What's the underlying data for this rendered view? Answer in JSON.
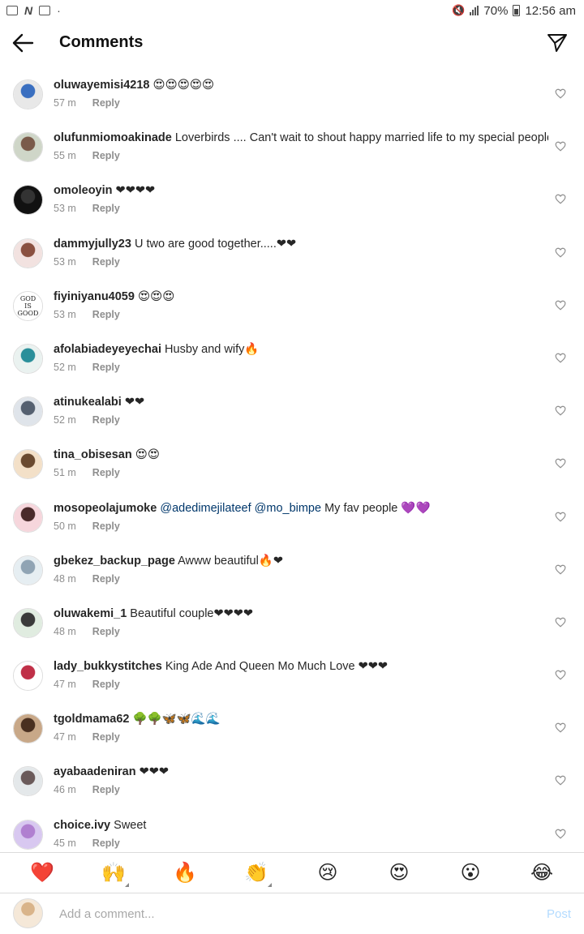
{
  "status_bar": {
    "battery": "70%",
    "time": "12:56 am",
    "left_n": "N",
    "dot": "·"
  },
  "header": {
    "title": "Comments",
    "back_icon": "arrow-left-icon",
    "send_icon": "paper-plane-icon"
  },
  "comments": [
    {
      "user": "oluwayemisi4218",
      "text": " 😍😍😍😍😍",
      "time": "57 m",
      "reply": "Reply",
      "avatar_colors": [
        "#e8e8e8",
        "#3a6fc0"
      ]
    },
    {
      "user": "olufunmiomoakinade",
      "text": " Loverbirds .... Can't wait to shout happy married life to my special people",
      "time": "55 m",
      "reply": "Reply",
      "avatar_colors": [
        "#cfd6c8",
        "#7a5a4a"
      ]
    },
    {
      "user": "omoleoyin",
      "text": " ❤❤❤❤",
      "time": "53 m",
      "reply": "Reply",
      "avatar_colors": [
        "#111111",
        "#333333"
      ]
    },
    {
      "user": "dammyjully23",
      "text": " U two are good together.....❤❤",
      "time": "53 m",
      "reply": "Reply",
      "avatar_colors": [
        "#f2e2e0",
        "#8a5040"
      ]
    },
    {
      "user": "fiyiniyanu4059",
      "text": " 😍😍😍",
      "time": "53 m",
      "reply": "Reply",
      "avatar_colors": [
        "#ffffff",
        "#ffffff"
      ],
      "avatar_text": [
        "GOD",
        "IS",
        "GOOD"
      ]
    },
    {
      "user": "afolabiadeyeyechai",
      "text": " Husby and wify🔥",
      "time": "52 m",
      "reply": "Reply",
      "avatar_colors": [
        "#eaf2f0",
        "#2a8f9a"
      ]
    },
    {
      "user": "atinukealabi",
      "text": " ❤❤",
      "time": "52 m",
      "reply": "Reply",
      "avatar_colors": [
        "#dfe4ea",
        "#556070"
      ]
    },
    {
      "user": "tina_obisesan",
      "text": " 😍😍",
      "time": "51 m",
      "reply": "Reply",
      "avatar_colors": [
        "#f3e0c8",
        "#6a4a30"
      ]
    },
    {
      "user": "mosopeolajumoke",
      "text": " ",
      "mentions": [
        "@adedimejilateef",
        "@mo_bimpe"
      ],
      "text_after": " My fav people 💜💜",
      "time": "50 m",
      "reply": "Reply",
      "avatar_colors": [
        "#f6d6dc",
        "#4a2a2a"
      ]
    },
    {
      "user": "gbekez_backup_page",
      "text": " Awww beautiful🔥❤",
      "time": "48 m",
      "reply": "Reply",
      "avatar_colors": [
        "#e6eef2",
        "#90a4b4"
      ]
    },
    {
      "user": "oluwakemi_1",
      "text": " Beautiful couple❤❤❤❤",
      "time": "48 m",
      "reply": "Reply",
      "avatar_colors": [
        "#e0ece0",
        "#3a3a3a"
      ]
    },
    {
      "user": "lady_bukkystitches",
      "text": " King Ade And Queen Mo Much Love ❤❤❤",
      "time": "47 m",
      "reply": "Reply",
      "avatar_colors": [
        "#ffffff",
        "#c03048"
      ]
    },
    {
      "user": "tgoldmama62",
      "text": " 🌳🌳🦋🦋🌊🌊",
      "time": "47 m",
      "reply": "Reply",
      "avatar_colors": [
        "#c8a888",
        "#4a3020"
      ]
    },
    {
      "user": "ayabaadeniran",
      "text": " ❤❤❤",
      "time": "46 m",
      "reply": "Reply",
      "avatar_colors": [
        "#e4e8ea",
        "#6a5a5a"
      ]
    },
    {
      "user": "choice.ivy",
      "text": " Sweet",
      "time": "45 m",
      "reply": "Reply",
      "avatar_colors": [
        "#d8c8f0",
        "#b080d0"
      ]
    }
  ],
  "emoji_bar": [
    {
      "glyph": "❤️",
      "name": "heart",
      "more": false
    },
    {
      "glyph": "🙌",
      "name": "raised-hands",
      "more": true
    },
    {
      "glyph": "🔥",
      "name": "fire",
      "more": false
    },
    {
      "glyph": "👏",
      "name": "clap",
      "more": true
    },
    {
      "glyph": "😢",
      "name": "crying",
      "more": false
    },
    {
      "glyph": "😍",
      "name": "heart-eyes",
      "more": false
    },
    {
      "glyph": "😮",
      "name": "surprised",
      "more": false
    },
    {
      "glyph": "😂",
      "name": "laughing",
      "more": false
    }
  ],
  "compose": {
    "placeholder": "Add a comment...",
    "post_label": "Post"
  },
  "colors": {
    "text": "#262626",
    "meta": "#8e8e8e",
    "mention": "#00376b",
    "post_disabled": "#b3dbff",
    "divider": "#dbdbdb"
  }
}
